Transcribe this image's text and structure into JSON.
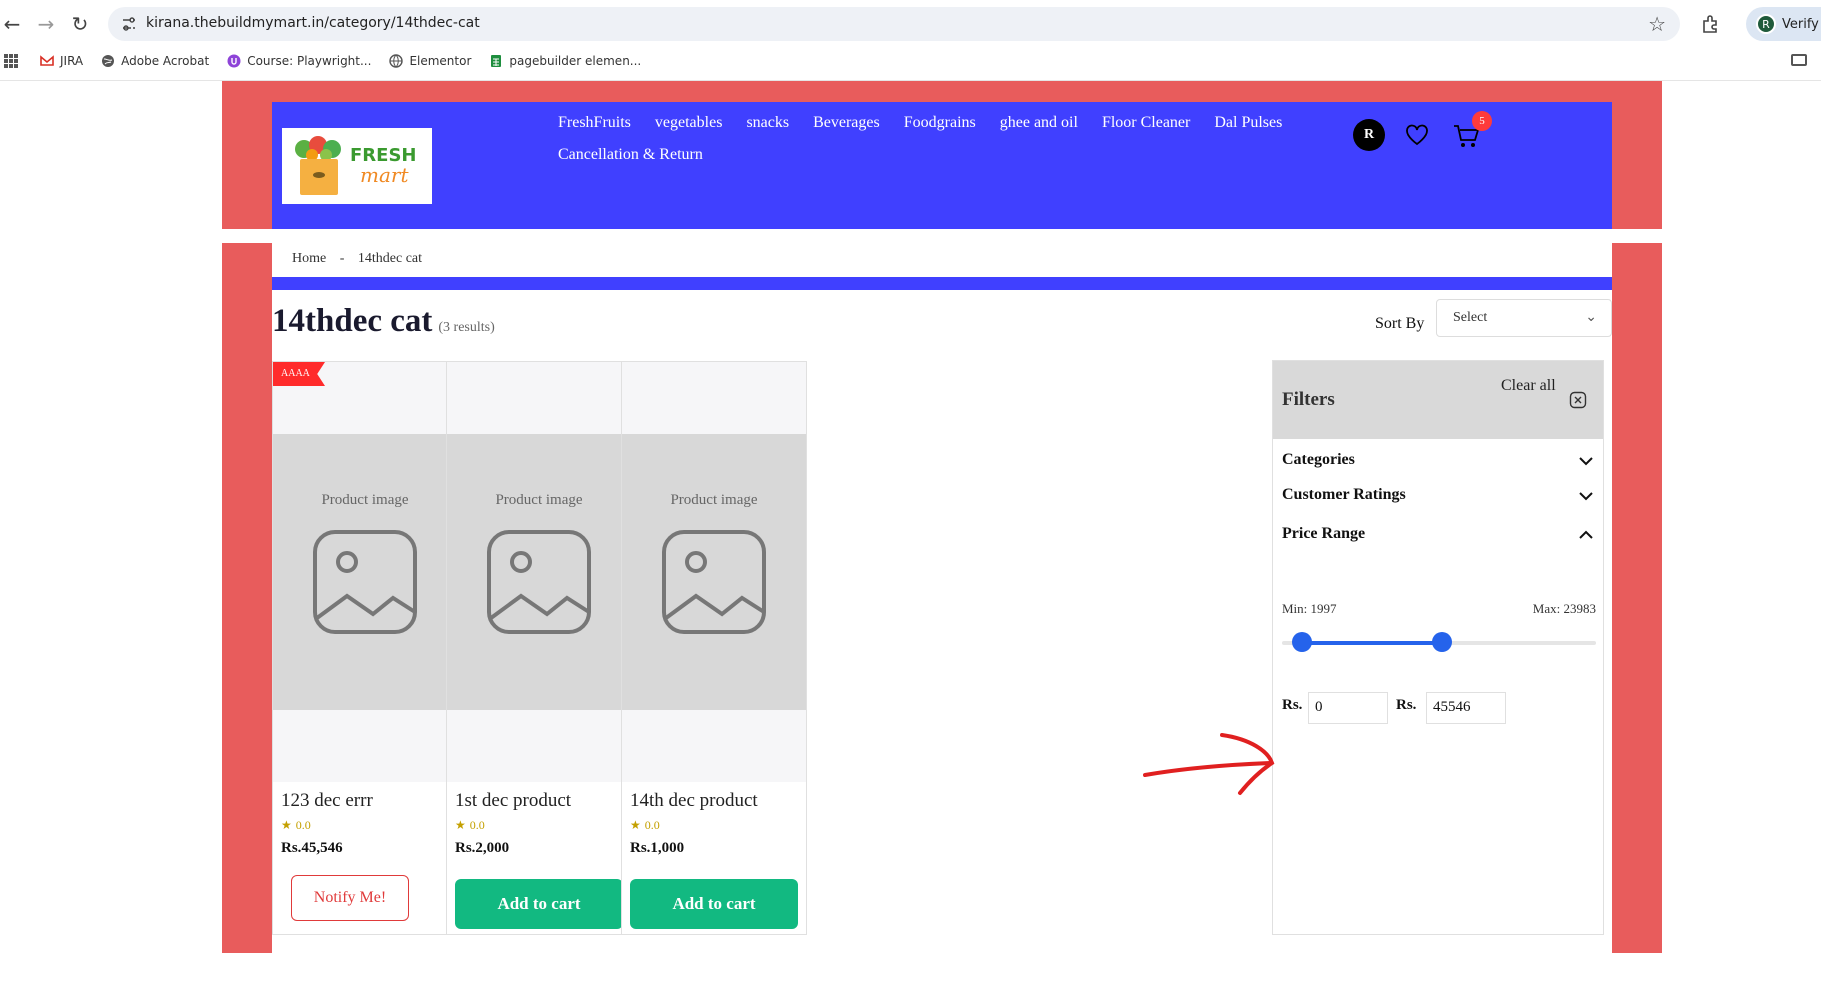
{
  "browser": {
    "url": "kirana.thebuildmymart.in/category/14thdec-cat",
    "profile_initial": "R",
    "profile_label": "Verify it",
    "bookmarks": [
      "JIRA",
      "Adobe Acrobat",
      "Course: Playwright...",
      "Elementor",
      "pagebuilder elemen..."
    ]
  },
  "header": {
    "logo_word1": "FRESH",
    "logo_word2": "mart",
    "menu": [
      "FreshFruits",
      "vegetables",
      "snacks",
      "Beverages",
      "Foodgrains",
      "ghee and oil",
      "Floor Cleaner",
      "Dal Pulses",
      "Cancellation & Return"
    ],
    "avatar_initial": "R",
    "cart_count": "5"
  },
  "breadcrumb": {
    "home": "Home",
    "separator": "-",
    "current": "14thdec cat"
  },
  "category": {
    "title": "14thdec cat",
    "results": "(3 results)",
    "sort_label": "Sort By",
    "sort_value": "Select"
  },
  "products": [
    {
      "name": "123 dec errr",
      "rating": "0.0",
      "price": "Rs.45,546",
      "badge": "AAAA",
      "image_text": "Product image",
      "action": "Notify Me!"
    },
    {
      "name": "1st dec product",
      "rating": "0.0",
      "price": "Rs.2,000",
      "badge": "",
      "image_text": "Product image",
      "action": "Add to cart"
    },
    {
      "name": "14th dec product",
      "rating": "0.0",
      "price": "Rs.1,000",
      "badge": "",
      "image_text": "Product image",
      "action": "Add to cart"
    }
  ],
  "filters": {
    "title": "Filters",
    "clear_all": "Clear all",
    "sections": [
      "Categories",
      "Customer Ratings",
      "Price Range"
    ],
    "min_label": "Min: 1997",
    "max_label": "Max: 23983",
    "currency": "Rs.",
    "min_value": "0",
    "max_value": "45546"
  },
  "colors": {
    "header_blue": "#4040ff",
    "frame_red": "#e85c5c",
    "add_to_cart": "#12b981",
    "slider": "#2563eb",
    "annotation_arrow": "#e02020"
  }
}
